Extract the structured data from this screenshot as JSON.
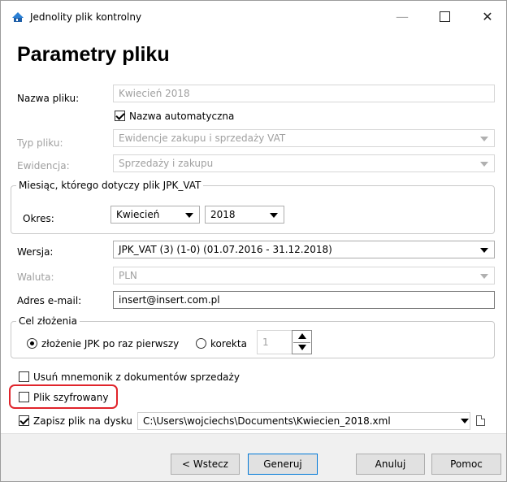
{
  "window": {
    "title": "Jednolity plik kontrolny",
    "icon": "app-logo-icon",
    "minimize_glyph": "—",
    "close_glyph": "✕"
  },
  "heading": "Parametry pliku",
  "form": {
    "nazwa_pliku": {
      "label": "Nazwa pliku:",
      "value": "Kwiecień 2018"
    },
    "nazwa_automatyczna": {
      "label": "Nazwa automatyczna",
      "checked": true
    },
    "typ_pliku": {
      "label": "Typ pliku:",
      "value": "Ewidencje zakupu i sprzedaży VAT"
    },
    "ewidencja": {
      "label": "Ewidencja:",
      "value": "Sprzedaży i zakupu"
    },
    "miesiac_group": {
      "title": "Miesiąc, którego dotyczy plik JPK_VAT",
      "okres_label": "Okres:",
      "month": "Kwiecień",
      "year": "2018"
    },
    "wersja": {
      "label": "Wersja:",
      "value": "JPK_VAT (3) (1-0) (01.07.2016 - 31.12.2018)"
    },
    "waluta": {
      "label": "Waluta:",
      "value": "PLN"
    },
    "email": {
      "label": "Adres e-mail:",
      "value": "insert@insert.com.pl"
    },
    "cel_group": {
      "title": "Cel złożenia",
      "option1": {
        "label": "złożenie JPK po raz pierwszy",
        "selected": true
      },
      "option2": {
        "label": "korekta",
        "selected": false
      },
      "korekta_value": "1"
    },
    "usun_mnemonik": {
      "label": "Usuń mnemonik z dokumentów sprzedaży",
      "checked": false
    },
    "plik_szyfrowany": {
      "label": "Plik szyfrowany",
      "checked": false
    },
    "zapisz": {
      "label": "Zapisz plik na dysku",
      "checked": true,
      "path": "C:\\Users\\wojciechs\\Documents\\Kwiecien_2018.xml"
    }
  },
  "buttons": {
    "back": "< Wstecz",
    "generate": "Generuj",
    "cancel": "Anuluj",
    "help": "Pomoc"
  },
  "colors": {
    "highlight": "#e0242b",
    "default_button_border": "#0078d7",
    "disabled_text": "#a0a0a0"
  }
}
